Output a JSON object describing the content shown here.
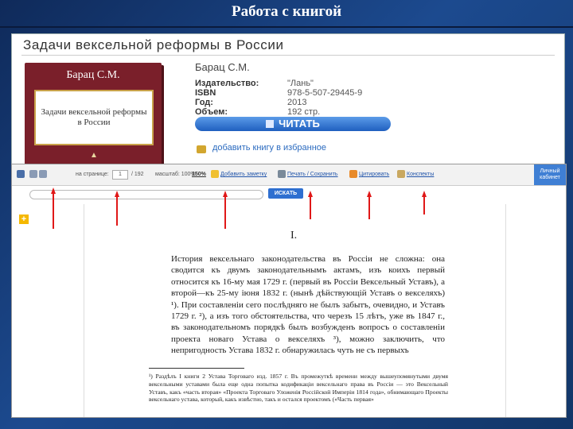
{
  "slide": {
    "title": "Работа с книгой"
  },
  "book_card": {
    "heading": "Задачи вексельной реформы в России",
    "cover": {
      "author": "Барац С.М.",
      "title": "Задачи вексельной реформы в России"
    },
    "author": "Барац С.М.",
    "meta": [
      {
        "key": "Издательство:",
        "value": "\"Лань\""
      },
      {
        "key": "ISBN",
        "value": "978-5-507-29445-9"
      },
      {
        "key": "Год:",
        "value": "2013"
      },
      {
        "key": "Объем:",
        "value": "192 стр."
      }
    ],
    "read_button": "ЧИТАТЬ",
    "favorite_link": "добавить книгу в избранное"
  },
  "reader": {
    "toolbar": {
      "page_label": "на странице:",
      "page_value": "1",
      "page_total": "/ 192",
      "zoom_label": "масштаб: 100%",
      "zoom_value": "150%",
      "add_note": "Добавить заметку",
      "print_save": "Печать / Сохранить",
      "cite": "Цитировать",
      "notes": "Конспекты",
      "cabinet": "Личный кабинет"
    },
    "search_button": "ИСКАТЬ",
    "chapter": "I.",
    "body_text": "История вексельнаго законодательства въ Россіи не сложна: она сводится къ двумъ законодательнымъ актамъ, изъ коихъ первый относится къ 16-му мая 1729 г. (первый въ Россіи Вексельный Уставъ), а второй—къ 25-му іюня 1832 г. (нынѣ дѣйствующій Уставъ о векселяхъ) ¹). При составленіи сего послѣдняго не былъ забытъ, очевидно, и Уставъ 1729 г. ²), а изъ того обстоятельства, что черезъ 15 лѣтъ, уже въ 1847 г., въ законодательномъ порядкѣ былъ возбужденъ вопросъ о составленіи проекта новаго Устава о векселяхъ ³), можно заключить, что непригодность Устава 1832 г. обнаружилась чуть не съ первыхъ",
    "footnote": "¹) Раздѣлъ I книги 2 Устава Торговаго изд. 1857 г. Въ промежуткѣ времени между вышеупомянутыми двумя вексельными уставами была еще одна попытка кодификаціи вексельнаго права въ Россіи — это Вексельный Уставъ, какъ «часть вторая» «Проекта Торговаго Уложенія Россійской Имперіи 1814 года», обнимающаго Проекты вексельнаго устава, который, какъ извѣстно, такъ и остался проектомъ («Часть первая»"
  },
  "colors": {
    "accent_red": "#e01818",
    "reader_blue": "#2e6fd0",
    "cover": "#7a1f2a"
  }
}
